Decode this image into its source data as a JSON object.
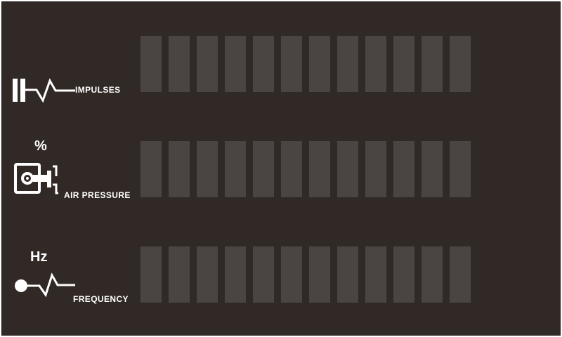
{
  "meters": [
    {
      "id": "impulses",
      "label": "IMPULSES",
      "unit": "",
      "icon": "impulse-icon",
      "segments_total": 12,
      "segments_lit": 0
    },
    {
      "id": "air-pressure",
      "label": "AIR PRESSURE",
      "unit": "%",
      "icon": "air-pressure-gauge-icon",
      "segments_total": 12,
      "segments_lit": 0
    },
    {
      "id": "frequency",
      "label": "FREQUENCY",
      "unit": "Hz",
      "icon": "frequency-pulse-icon",
      "segments_total": 12,
      "segments_lit": 0
    }
  ],
  "colors": {
    "panel_background": "#312926",
    "segment_off": "#4a4543",
    "segment_on": "#e9e2dc",
    "text": "#ffffff"
  }
}
